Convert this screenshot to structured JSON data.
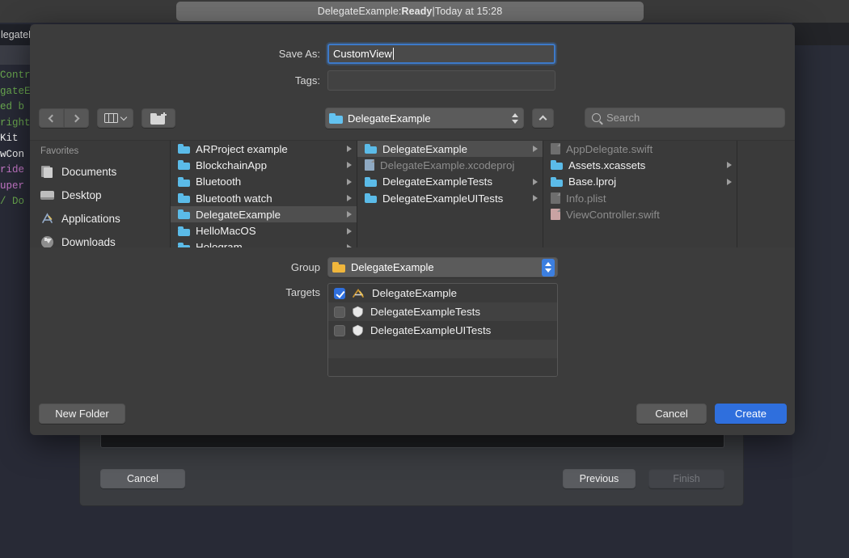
{
  "background": {
    "status_prefix": "DelegateExample: ",
    "status_bold": "Ready",
    "status_separator": " | ",
    "status_suffix": "Today at 15:28",
    "tab_label": "legateE",
    "code_lines": [
      {
        "text": "Contr",
        "color": "green"
      },
      {
        "text": "gateE",
        "color": "green"
      },
      {
        "text": "",
        "color": "green"
      },
      {
        "text": "ed b",
        "color": "green"
      },
      {
        "text": "right",
        "color": "green"
      },
      {
        "text": "",
        "color": "white"
      },
      {
        "text": "Kit",
        "color": "white"
      },
      {
        "text": "",
        "color": "white"
      },
      {
        "text": "wCon",
        "color": "white"
      },
      {
        "text": "",
        "color": "pink"
      },
      {
        "text": "ride",
        "color": "pink"
      },
      {
        "text": "uper",
        "color": "pink"
      },
      {
        "text": "/ Do",
        "color": "green"
      }
    ],
    "cancel_label": "Cancel",
    "previous_label": "Previous",
    "finish_label": "Finish"
  },
  "panel": {
    "save_as_label": "Save As:",
    "save_as_value": "CustomView",
    "tags_label": "Tags:",
    "tags_value": "",
    "toolbar": {
      "back_icon": "chevron-left-icon",
      "forward_icon": "chevron-right-icon",
      "view_icon": "column-view-icon",
      "new_folder_icon": "new-folder-icon",
      "path_label": "DelegateExample",
      "up_icon": "chevron-up-icon",
      "search_placeholder": "Search"
    },
    "sidebar": {
      "header": "Favorites",
      "items": [
        {
          "label": "Documents",
          "icon": "documents-icon"
        },
        {
          "label": "Desktop",
          "icon": "desktop-icon"
        },
        {
          "label": "Applications",
          "icon": "applications-icon"
        },
        {
          "label": "Downloads",
          "icon": "downloads-icon"
        }
      ]
    },
    "columns": [
      {
        "name": "column-1",
        "rows": [
          {
            "label": "ARProject example",
            "type": "folder",
            "arrow": true,
            "selected": false,
            "dim": false
          },
          {
            "label": "BlockchainApp",
            "type": "folder",
            "arrow": true,
            "selected": false,
            "dim": false
          },
          {
            "label": "Bluetooth",
            "type": "folder",
            "arrow": true,
            "selected": false,
            "dim": false
          },
          {
            "label": "Bluetooth watch",
            "type": "folder",
            "arrow": true,
            "selected": false,
            "dim": false
          },
          {
            "label": "DelegateExample",
            "type": "folder",
            "arrow": true,
            "selected": true,
            "dim": false
          },
          {
            "label": "HelloMacOS",
            "type": "folder",
            "arrow": true,
            "selected": false,
            "dim": false
          },
          {
            "label": "Hologram",
            "type": "folder",
            "arrow": true,
            "selected": false,
            "dim": false
          }
        ]
      },
      {
        "name": "column-2",
        "rows": [
          {
            "label": "DelegateExample",
            "type": "folder",
            "arrow": true,
            "selected": true,
            "dim": false
          },
          {
            "label": "DelegateExample.xcodeproj",
            "type": "bluedoc",
            "arrow": false,
            "selected": false,
            "dim": true
          },
          {
            "label": "DelegateExampleTests",
            "type": "folder",
            "arrow": true,
            "selected": false,
            "dim": false
          },
          {
            "label": "DelegateExampleUITests",
            "type": "folder",
            "arrow": true,
            "selected": false,
            "dim": false
          }
        ]
      },
      {
        "name": "column-3",
        "rows": [
          {
            "label": "AppDelegate.swift",
            "type": "dimdoc",
            "arrow": false,
            "selected": false,
            "dim": true
          },
          {
            "label": "Assets.xcassets",
            "type": "folder",
            "arrow": true,
            "selected": false,
            "dim": false
          },
          {
            "label": "Base.lproj",
            "type": "folder",
            "arrow": true,
            "selected": false,
            "dim": false
          },
          {
            "label": "Info.plist",
            "type": "dimdoc",
            "arrow": false,
            "selected": false,
            "dim": true
          },
          {
            "label": "ViewController.swift",
            "type": "reddoc",
            "arrow": false,
            "selected": false,
            "dim": true
          }
        ]
      }
    ],
    "group_label": "Group",
    "group_value": "DelegateExample",
    "targets_label": "Targets",
    "targets": [
      {
        "label": "DelegateExample",
        "checked": true,
        "icon": "xcode-target-icon"
      },
      {
        "label": "DelegateExampleTests",
        "checked": false,
        "icon": "shield-target-icon"
      },
      {
        "label": "DelegateExampleUITests",
        "checked": false,
        "icon": "shield-target-icon"
      }
    ],
    "new_folder_label": "New Folder",
    "cancel_label": "Cancel",
    "create_label": "Create"
  },
  "colors": {
    "accent": "#2f6fdd",
    "folder_blue": "#5bbbe8",
    "folder_yellow": "#f0b63c",
    "panel_bg": "#3c3c3c"
  }
}
